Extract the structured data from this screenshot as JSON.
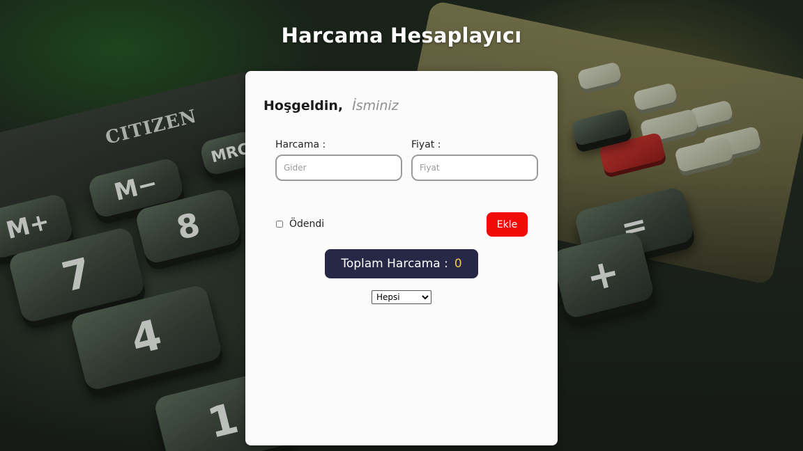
{
  "app": {
    "title": "Harcama Hesaplayıcı"
  },
  "welcome": {
    "greeting": "Hoşgeldin,",
    "name_placeholder": "İsminiz"
  },
  "form": {
    "expense_label": "Harcama :",
    "expense_placeholder": "Gider",
    "expense_value": "",
    "price_label": "Fiyat :",
    "price_placeholder": "Fiyat",
    "price_value": "",
    "paid_label": "Ödendi",
    "paid_checked": false,
    "add_button": "Ekle"
  },
  "summary": {
    "total_label": "Toplam Harcama :",
    "total_value": "0"
  },
  "filter": {
    "selected": "Hepsi"
  },
  "colors": {
    "add_button": "#f20a06",
    "total_bg": "#272845",
    "total_value": "#f2c94c",
    "card_bg": "#fbfbfb"
  }
}
